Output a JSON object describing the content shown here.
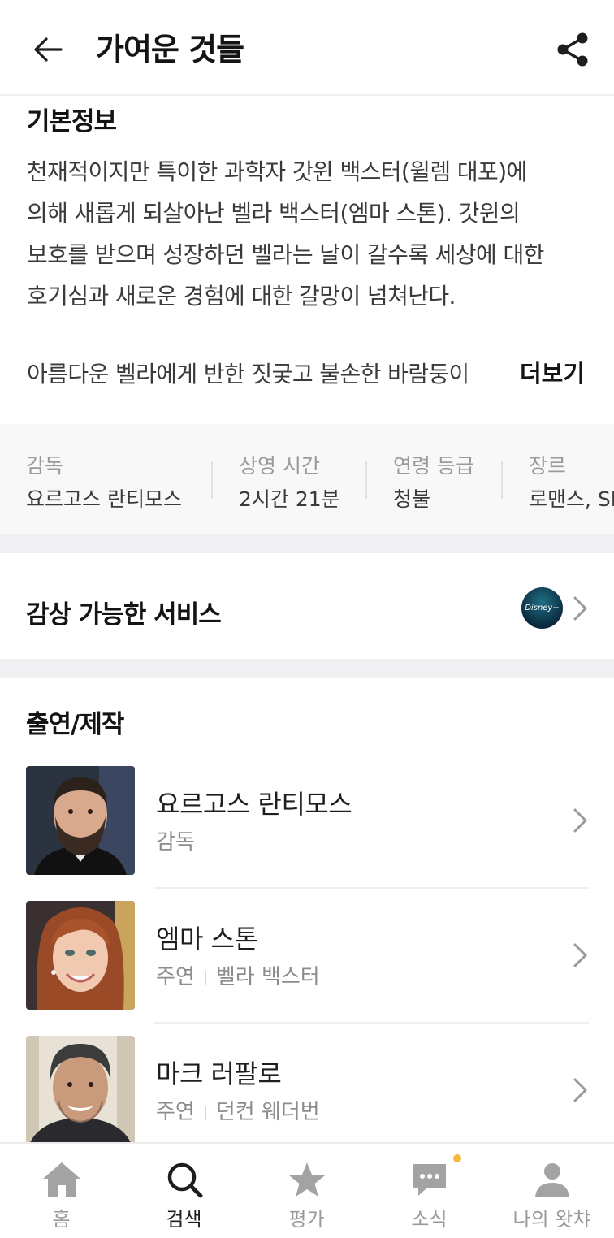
{
  "header": {
    "title": "가여운 것들"
  },
  "basic_info": {
    "title": "기본정보",
    "synopsis_lines": [
      "천재적이지만 특이한 과학자 갓윈 백스터(윌렘 대포)에",
      "의해 새롭게 되살아난 벨라 백스터(엠마 스톤). 갓윈의",
      "보호를 받으며 성장하던 벨라는 날이 갈수록 세상에 대한",
      "호기심과 새로운 경험에 대한 갈망이 넘쳐난다."
    ],
    "synopsis_truncated": "아름다운 벨라에게 반한 짓궂고 불손한 바람둥이",
    "more_label": "더보기"
  },
  "meta": [
    {
      "label": "감독",
      "value": "요르고스 란티모스"
    },
    {
      "label": "상영 시간",
      "value": "2시간 21분"
    },
    {
      "label": "연령 등급",
      "value": "청불"
    },
    {
      "label": "장르",
      "value": "로맨스, SF"
    }
  ],
  "services": {
    "title": "감상 가능한 서비스",
    "logo_text": "Disney+"
  },
  "cast": {
    "title": "출연/제작",
    "people": [
      {
        "name": "요르고스 란티모스",
        "role": "감독",
        "character": ""
      },
      {
        "name": "엠마 스톤",
        "role": "주연",
        "character": "벨라 백스터"
      },
      {
        "name": "마크 러팔로",
        "role": "주연",
        "character": "던컨 웨더번"
      }
    ]
  },
  "nav": {
    "items": [
      {
        "label": "홈",
        "icon": "home-icon"
      },
      {
        "label": "검색",
        "icon": "search-icon"
      },
      {
        "label": "평가",
        "icon": "star-icon"
      },
      {
        "label": "소식",
        "icon": "chat-icon"
      },
      {
        "label": "나의 왓챠",
        "icon": "user-icon"
      }
    ],
    "active_index": 1,
    "notification_color": "#f6b93b"
  }
}
